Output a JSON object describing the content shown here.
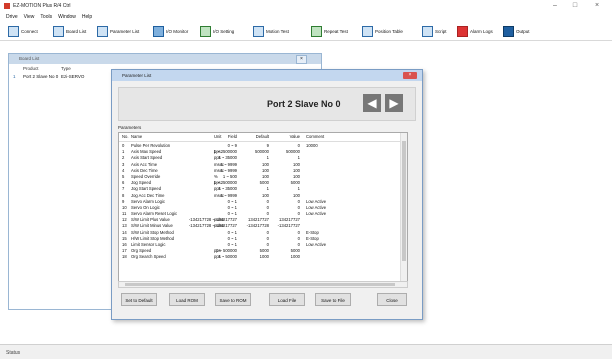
{
  "app": {
    "title": "EZ-MOTION Plus R/4 Ctrl"
  },
  "window_controls": {
    "minimize": "–",
    "maximize": "□",
    "close": "×"
  },
  "menu": [
    "Drive",
    "View",
    "Tools",
    "Window",
    "Help"
  ],
  "toolbar": [
    {
      "label": "Connect",
      "icon": "plug-icon"
    },
    {
      "label": "Board List",
      "icon": "list-icon"
    },
    {
      "label": "Parameter List",
      "icon": "params-icon"
    },
    {
      "label": "I/O Monitor",
      "icon": "io-monitor-icon"
    },
    {
      "label": "I/O Setting",
      "icon": "io-setting-icon"
    },
    {
      "label": "Motion Test",
      "icon": "motion-icon"
    },
    {
      "label": "Repeat Test",
      "icon": "repeat-icon"
    },
    {
      "label": "Position Table",
      "icon": "table-icon"
    },
    {
      "label": "Script",
      "icon": "script-icon"
    },
    {
      "label": "Alarm Logs",
      "icon": "alarm-icon"
    },
    {
      "label": "Output",
      "icon": "output-icon"
    }
  ],
  "board_list": {
    "title": "Board List",
    "columns": [
      "Product",
      "Type"
    ],
    "row": {
      "marker": "1",
      "product": "Port 2 Slave No 0",
      "type": "Ezi-SERVO"
    }
  },
  "param_window": {
    "title": "Parameter List",
    "header": "Port 2 Slave No 0",
    "section_label": "Parameters",
    "columns": [
      "No.",
      "Name",
      "Unit",
      "Field",
      "Default",
      "Value",
      "Comment"
    ],
    "rows": [
      {
        "no": "0",
        "name": "Pulse Per Revolution",
        "unit": "",
        "field": "0 ~ 9",
        "default": "9",
        "value": "0",
        "comment": "10000"
      },
      {
        "no": "1",
        "name": "Axis Max Speed",
        "unit": "pps",
        "field": "1 ~ 2500000",
        "default": "500000",
        "value": "500000",
        "comment": ""
      },
      {
        "no": "2",
        "name": "Axis Start Speed",
        "unit": "pps",
        "field": "1 ~ 35000",
        "default": "1",
        "value": "1",
        "comment": ""
      },
      {
        "no": "3",
        "name": "Axis Acc Time",
        "unit": "msec",
        "field": "1 ~ 9999",
        "default": "100",
        "value": "100",
        "comment": ""
      },
      {
        "no": "4",
        "name": "Axis Dec Time",
        "unit": "msec",
        "field": "1 ~ 9999",
        "default": "100",
        "value": "100",
        "comment": ""
      },
      {
        "no": "5",
        "name": "Speed Override",
        "unit": "%",
        "field": "1 ~ 500",
        "default": "100",
        "value": "100",
        "comment": ""
      },
      {
        "no": "6",
        "name": "Jog Speed",
        "unit": "pps",
        "field": "1 ~ 2500000",
        "default": "5000",
        "value": "5000",
        "comment": ""
      },
      {
        "no": "7",
        "name": "Jog Start Speed",
        "unit": "pps",
        "field": "1 ~ 35000",
        "default": "1",
        "value": "1",
        "comment": ""
      },
      {
        "no": "8",
        "name": "Jog Acc Dec Time",
        "unit": "msec",
        "field": "1 ~ 9999",
        "default": "100",
        "value": "100",
        "comment": ""
      },
      {
        "no": "9",
        "name": "Servo Alarm Logic",
        "unit": "",
        "field": "0 ~ 1",
        "default": "0",
        "value": "0",
        "comment": "Low Active"
      },
      {
        "no": "10",
        "name": "Servo On Logic",
        "unit": "",
        "field": "0 ~ 1",
        "default": "0",
        "value": "0",
        "comment": "Low Active"
      },
      {
        "no": "11",
        "name": "Servo Alarm Reset Logic",
        "unit": "",
        "field": "0 ~ 1",
        "default": "0",
        "value": "0",
        "comment": "Low Active"
      },
      {
        "no": "12",
        "name": "S/W Limit Plus Value",
        "unit": "pulse",
        "field": "-134217728 ~ 134217727",
        "default": "134217727",
        "value": "134217727",
        "comment": ""
      },
      {
        "no": "13",
        "name": "S/W Limit Minus Value",
        "unit": "pulse",
        "field": "-134217728 ~ 134217727",
        "default": "-134217728",
        "value": "-134217727",
        "comment": ""
      },
      {
        "no": "14",
        "name": "S/W Limit Stop Method",
        "unit": "",
        "field": "0 ~ 1",
        "default": "0",
        "value": "0",
        "comment": "E-Stop"
      },
      {
        "no": "15",
        "name": "H/W Limit Stop Method",
        "unit": "",
        "field": "0 ~ 1",
        "default": "0",
        "value": "0",
        "comment": "E-Stop"
      },
      {
        "no": "16",
        "name": "Limit Sensor Logic",
        "unit": "",
        "field": "0 ~ 1",
        "default": "0",
        "value": "0",
        "comment": "Low Active"
      },
      {
        "no": "17",
        "name": "Org Speed",
        "unit": "pps",
        "field": "1 ~ 500000",
        "default": "5000",
        "value": "5000",
        "comment": ""
      },
      {
        "no": "18",
        "name": "Org Search Speed",
        "unit": "pps",
        "field": "1 ~ 50000",
        "default": "1000",
        "value": "1000",
        "comment": ""
      }
    ],
    "buttons": [
      "Set to Default",
      "Load ROM",
      "Save to ROM",
      "Load File",
      "Save to File",
      "Close"
    ]
  },
  "status": {
    "text": "Status"
  },
  "colors": {
    "accent": "#2d6aa6",
    "title_bar": "#c3d7ef",
    "close": "#d9534f"
  }
}
